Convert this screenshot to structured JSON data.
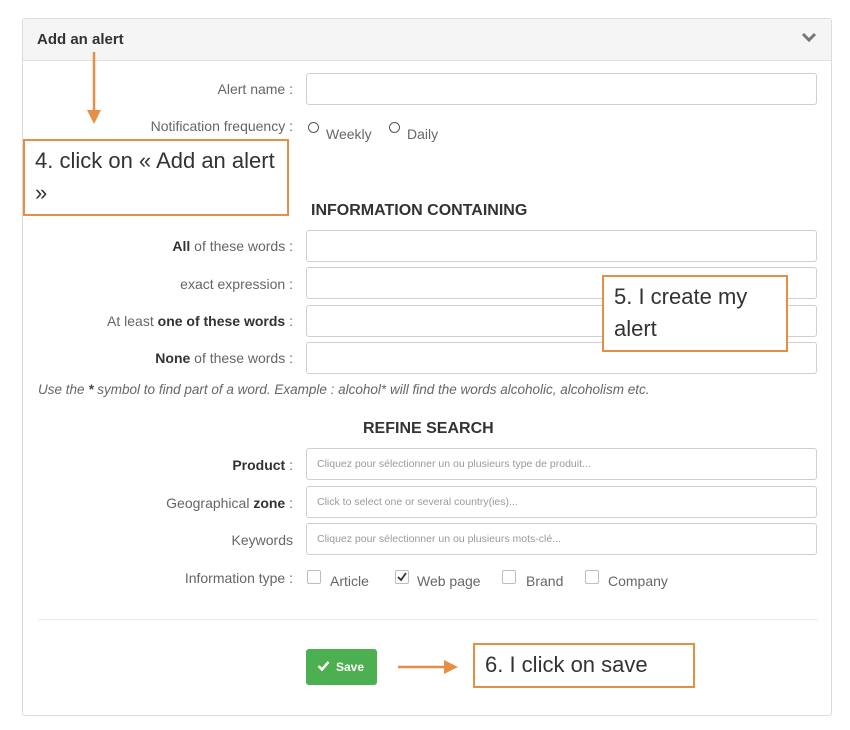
{
  "panel": {
    "title": "Add an alert"
  },
  "form": {
    "alert_name_label": "Alert name :",
    "notification_label": "Notification frequency :",
    "frequency_options": [
      "Weekly",
      "Daily"
    ]
  },
  "info_section": {
    "title": "INFORMATION CONTAINING",
    "all_words_bold": "All",
    "all_words_rest": " of these words :",
    "exact_expression_label": "exact expression :",
    "at_least_prefix": "At least ",
    "at_least_bold": "one of these words",
    "at_least_suffix": " :",
    "none_bold": "None",
    "none_rest": " of these words :",
    "hint_prefix": "Use the ",
    "hint_symbol": "*",
    "hint_rest": " symbol to find part of a word. Example : alcohol* will find the words alcoholic, alcoholism etc."
  },
  "refine_section": {
    "title": "REFINE SEARCH",
    "product_label": "Product",
    "product_colon": " :",
    "product_placeholder": "Cliquez pour sélectionner un ou plusieurs type de produit...",
    "zone_prefix": "Geographical ",
    "zone_bold": "zone",
    "zone_colon": " :",
    "zone_placeholder": "Click to select one or several country(ies)...",
    "keywords_label": "Keywords",
    "keywords_placeholder": "Cliquez pour sélectionner un ou plusieurs mots-clé...",
    "info_type_label": "Information type :",
    "info_types": [
      {
        "label": "Article",
        "checked": false
      },
      {
        "label": "Web page",
        "checked": true
      },
      {
        "label": "Brand",
        "checked": false
      },
      {
        "label": "Company",
        "checked": false
      }
    ]
  },
  "save_label": "Save",
  "callouts": {
    "step4": "4. click on « Add an alert »",
    "step5": "5. I create my alert",
    "step6": "6. I click on save"
  },
  "colors": {
    "accent_orange": "#e39046",
    "save_green": "#4caf50"
  }
}
